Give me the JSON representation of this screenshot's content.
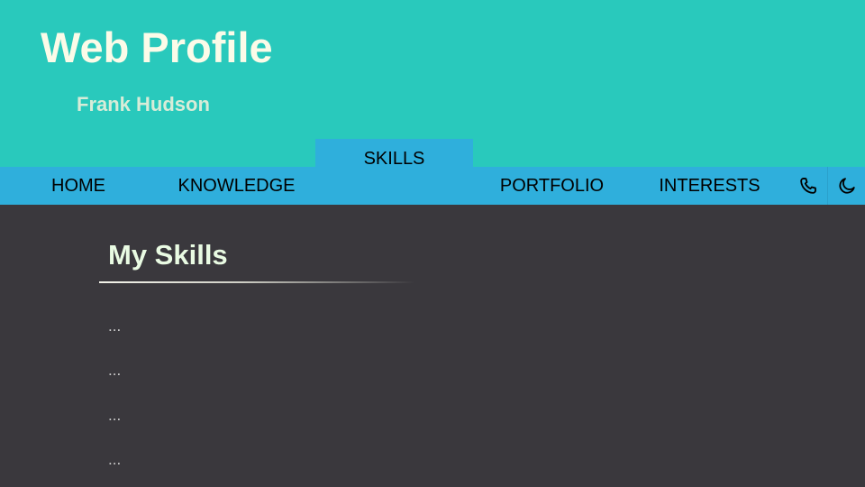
{
  "header": {
    "title": "Web Profile",
    "subtitle": "Frank Hudson"
  },
  "nav": {
    "items": [
      {
        "label": "HOME"
      },
      {
        "label": "KNOWLEDGE"
      },
      {
        "label": "SKILLS",
        "active": true
      },
      {
        "label": "PORTFOLIO"
      },
      {
        "label": "INTERESTS"
      }
    ],
    "icons": [
      "phone-icon",
      "moon-icon"
    ]
  },
  "main": {
    "section_title": "My Skills",
    "skills": [
      "...",
      "...",
      "...",
      "..."
    ]
  },
  "colors": {
    "header_bg": "#29c9bc",
    "nav_bg": "#2fafdc",
    "body_bg": "#3a383d",
    "title_text": "#fbfbe8"
  }
}
